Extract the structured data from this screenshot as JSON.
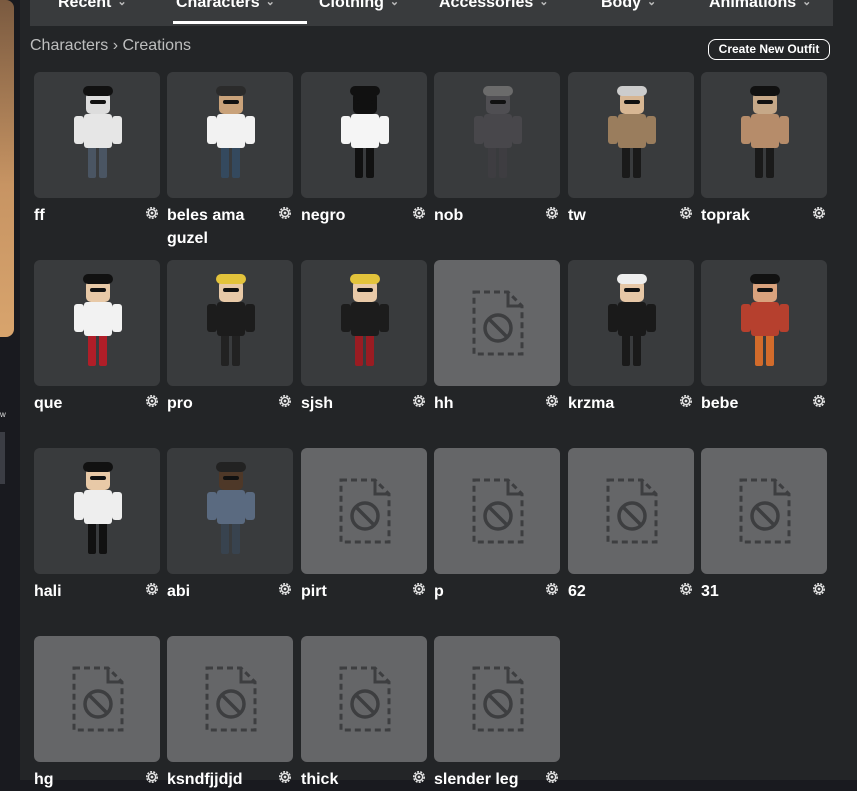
{
  "nav": {
    "tabs": [
      {
        "label": "Recent"
      },
      {
        "label": "Characters"
      },
      {
        "label": "Clothing"
      },
      {
        "label": "Accessories"
      },
      {
        "label": "Body"
      },
      {
        "label": "Animations"
      }
    ]
  },
  "breadcrumb": {
    "parent": "Characters",
    "separator": "›",
    "current": "Creations"
  },
  "actions": {
    "create_new_outfit": "Create New Outfit"
  },
  "side_label": "w",
  "outfits": [
    {
      "name": "ff",
      "thumbnail": "avatar"
    },
    {
      "name": "beles ama guzel",
      "thumbnail": "avatar"
    },
    {
      "name": "negro",
      "thumbnail": "avatar"
    },
    {
      "name": "nob",
      "thumbnail": "avatar"
    },
    {
      "name": "tw",
      "thumbnail": "avatar"
    },
    {
      "name": "toprak",
      "thumbnail": "avatar"
    },
    {
      "name": "que",
      "thumbnail": "avatar"
    },
    {
      "name": "pro",
      "thumbnail": "avatar"
    },
    {
      "name": "sjsh",
      "thumbnail": "avatar"
    },
    {
      "name": "hh",
      "thumbnail": "unavailable"
    },
    {
      "name": "krzma",
      "thumbnail": "avatar"
    },
    {
      "name": "bebe",
      "thumbnail": "avatar"
    },
    {
      "name": "hali",
      "thumbnail": "avatar"
    },
    {
      "name": "abi",
      "thumbnail": "avatar"
    },
    {
      "name": "pirt",
      "thumbnail": "unavailable"
    },
    {
      "name": "p",
      "thumbnail": "unavailable"
    },
    {
      "name": "62",
      "thumbnail": "unavailable"
    },
    {
      "name": "31",
      "thumbnail": "unavailable"
    },
    {
      "name": "hg",
      "thumbnail": "unavailable"
    },
    {
      "name": "ksndfjjdjd",
      "thumbnail": "unavailable"
    },
    {
      "name": "thick",
      "thumbnail": "unavailable"
    },
    {
      "name": "slender leg",
      "thumbnail": "unavailable"
    }
  ],
  "colors": {
    "thumbnail_bg": "#393b3d",
    "unavailable_bg": "#656668",
    "page_bg": "#232527",
    "nav_bg": "#393b3d"
  },
  "icons": {
    "settings": "gear-icon",
    "unavailable": "file-unavailable-icon",
    "dropdown": "chevron-down-icon"
  }
}
